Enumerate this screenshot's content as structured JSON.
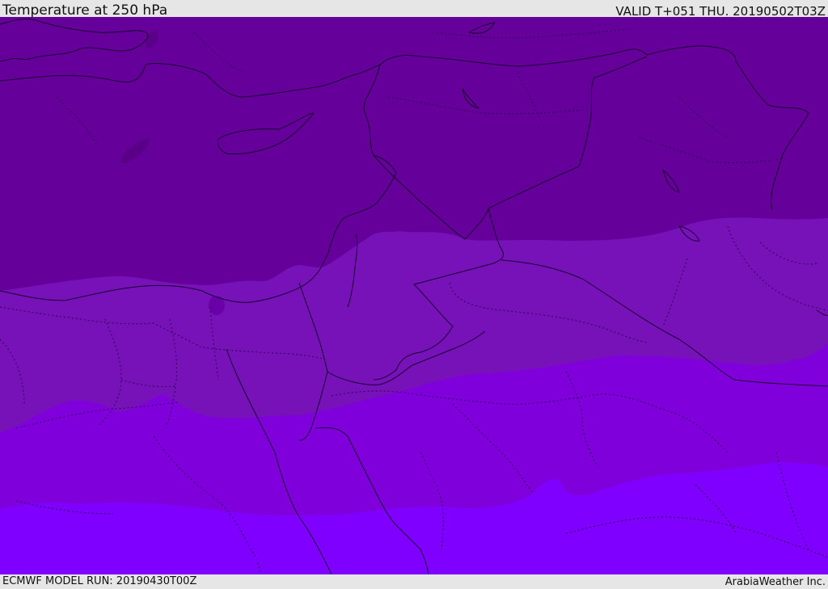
{
  "header": {
    "title": "Temperature at 250 hPa",
    "valid": "VALID T+051 THU. 20190502T03Z"
  },
  "footer": {
    "model_run": "ECMWF MODEL RUN: 20190430T00Z",
    "credit": "ArabiaWeather Inc."
  },
  "colors": {
    "band_coldest": "#66009a",
    "band_cold": "#7612b8",
    "band_mid": "#8000dc",
    "band_warm": "#8000ff",
    "lines": "#1a0030"
  }
}
